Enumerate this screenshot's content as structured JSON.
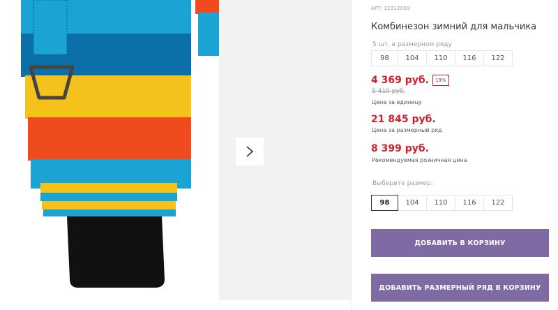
{
  "product": {
    "sku_label": "АРТ:",
    "sku_value": "32312059",
    "title": "Комбинезон зимний для мальчика",
    "pack_note": "5 шт. в размерном ряду",
    "pack_sizes": [
      "98",
      "104",
      "110",
      "116",
      "122"
    ],
    "price": "4 369 руб.",
    "discount": "19%",
    "old_price": "5 410 руб.",
    "price_caption": "Цена за единицу",
    "pack_price": "21 845 руб.",
    "pack_price_caption": "Цена за размерный ряд",
    "retail_price": "8 399 руб.",
    "retail_price_caption": "Рекомендуемая розничная цена",
    "select_size_label": "Выберите размер:",
    "select_sizes": [
      "98",
      "104",
      "110",
      "116",
      "122"
    ],
    "selected_size": "98",
    "add_to_cart_label": "ДОБАВИТЬ В КОРЗИНУ",
    "add_pack_to_cart_label": "ДОБАВИТЬ РАЗМЕРНЫЙ РЯД В КОРЗИНУ"
  },
  "colors": {
    "accent_button": "#7f6aa3",
    "price_red": "#d0202e"
  },
  "gallery": {
    "next_icon": "chevron-right-icon"
  }
}
